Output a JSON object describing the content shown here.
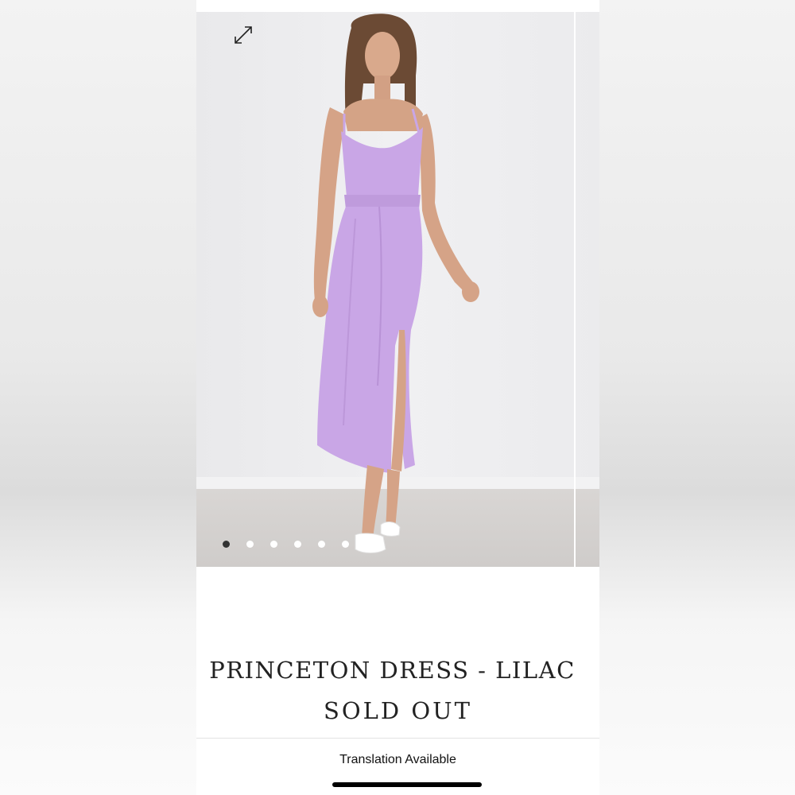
{
  "product": {
    "title": "PRINCETON DRESS - LILAC",
    "status": "SOLD OUT"
  },
  "gallery": {
    "image_count": 7,
    "active_index": 0,
    "expand_icon": "expand-arrows-icon",
    "dress_color": "#c9a6e6"
  },
  "footer": {
    "translation_label": "Translation Available"
  }
}
